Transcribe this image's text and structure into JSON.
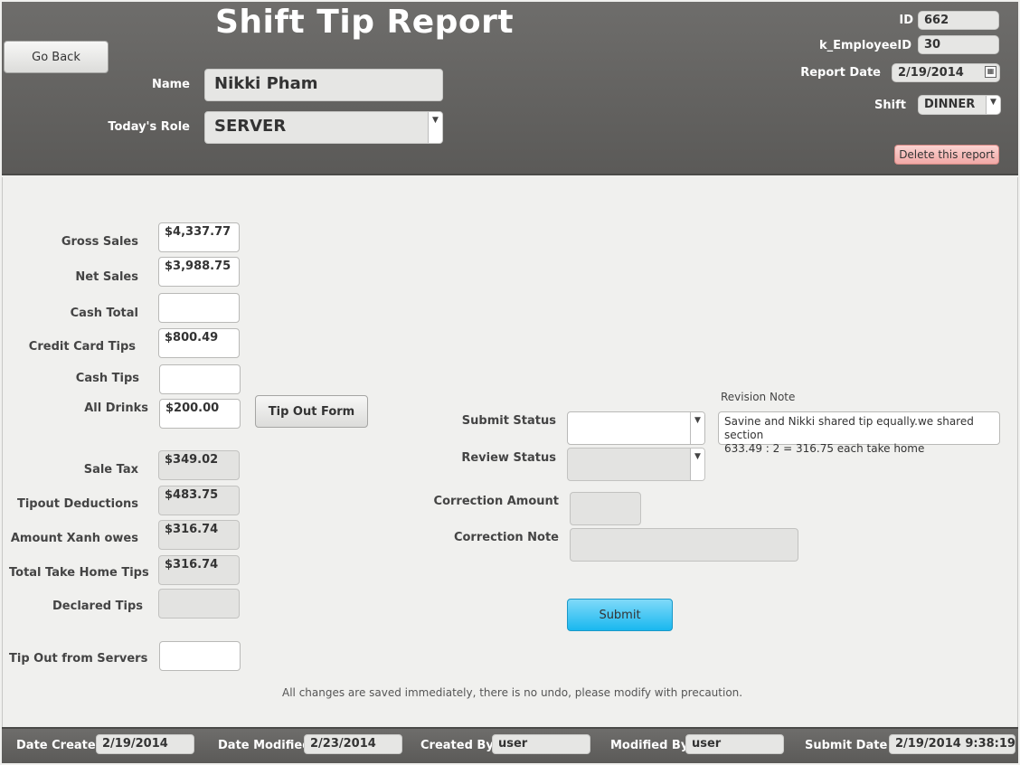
{
  "header": {
    "title": "Shift Tip Report",
    "go_back_label": "Go Back",
    "name_label": "Name",
    "name_value": "Nikki Pham",
    "role_label": "Today's Role",
    "role_value": "SERVER",
    "id_label": "ID",
    "id_value": "662",
    "employee_id_label": "k_EmployeeID",
    "employee_id_value": "30",
    "report_date_label": "Report Date",
    "report_date_value": "2/19/2014",
    "shift_label": "Shift",
    "shift_value": "DINNER",
    "delete_label": "Delete this report"
  },
  "fields": [
    {
      "label": "Gross Sales",
      "value": "$4,337.77"
    },
    {
      "label": "Net Sales",
      "value": "$3,988.75"
    },
    {
      "label": "Cash Total",
      "value": ""
    },
    {
      "label": "Credit Card Tips",
      "value": "$800.49"
    },
    {
      "label": "Cash Tips",
      "value": ""
    },
    {
      "label": "All Drinks",
      "value": "$200.00"
    },
    {
      "label": "Sale Tax",
      "value": "$349.02"
    },
    {
      "label": "Tipout Deductions",
      "value": "$483.75"
    },
    {
      "label": "Amount Xanh owes",
      "value": "$316.74"
    },
    {
      "label": "Total Take Home Tips",
      "value": "$316.74"
    },
    {
      "label": "Declared Tips",
      "value": ""
    },
    {
      "label": "Tip Out from Servers",
      "value": ""
    }
  ],
  "tip_out_form_label": "Tip Out Form",
  "review": {
    "revision_note_label": "Revision Note",
    "revision_note_value": "Savine and Nikki shared tip equally.we shared section\n633.49 : 2 = 316.75 each take home",
    "submit_status_label": "Submit Status",
    "submit_status_value": "",
    "review_status_label": "Review Status",
    "review_status_value": "",
    "correction_amount_label": "Correction Amount",
    "correction_amount_value": "",
    "correction_note_label": "Correction Note",
    "correction_note_value": "",
    "submit_label": "Submit"
  },
  "notice": "All changes are saved immediately, there is no undo, please modify with precaution.",
  "footer": {
    "date_created_label": "Date Created",
    "date_created_value": "2/19/2014",
    "date_modified_label": "Date Modified",
    "date_modified_value": "2/23/2014",
    "created_by_label": "Created By",
    "created_by_value": "user",
    "modified_by_label": "Modified By",
    "modified_by_value": "user",
    "submit_date_label": "Submit Date",
    "submit_date_value": "2/19/2014 9:38:19"
  },
  "icons": {
    "calendar": "calendar-icon",
    "dropdown": "chevron-down-icon"
  },
  "colors": {
    "header_bg": "#646361",
    "submit_blue": "#19b8ef",
    "delete_pink": "#f1a9a6"
  }
}
